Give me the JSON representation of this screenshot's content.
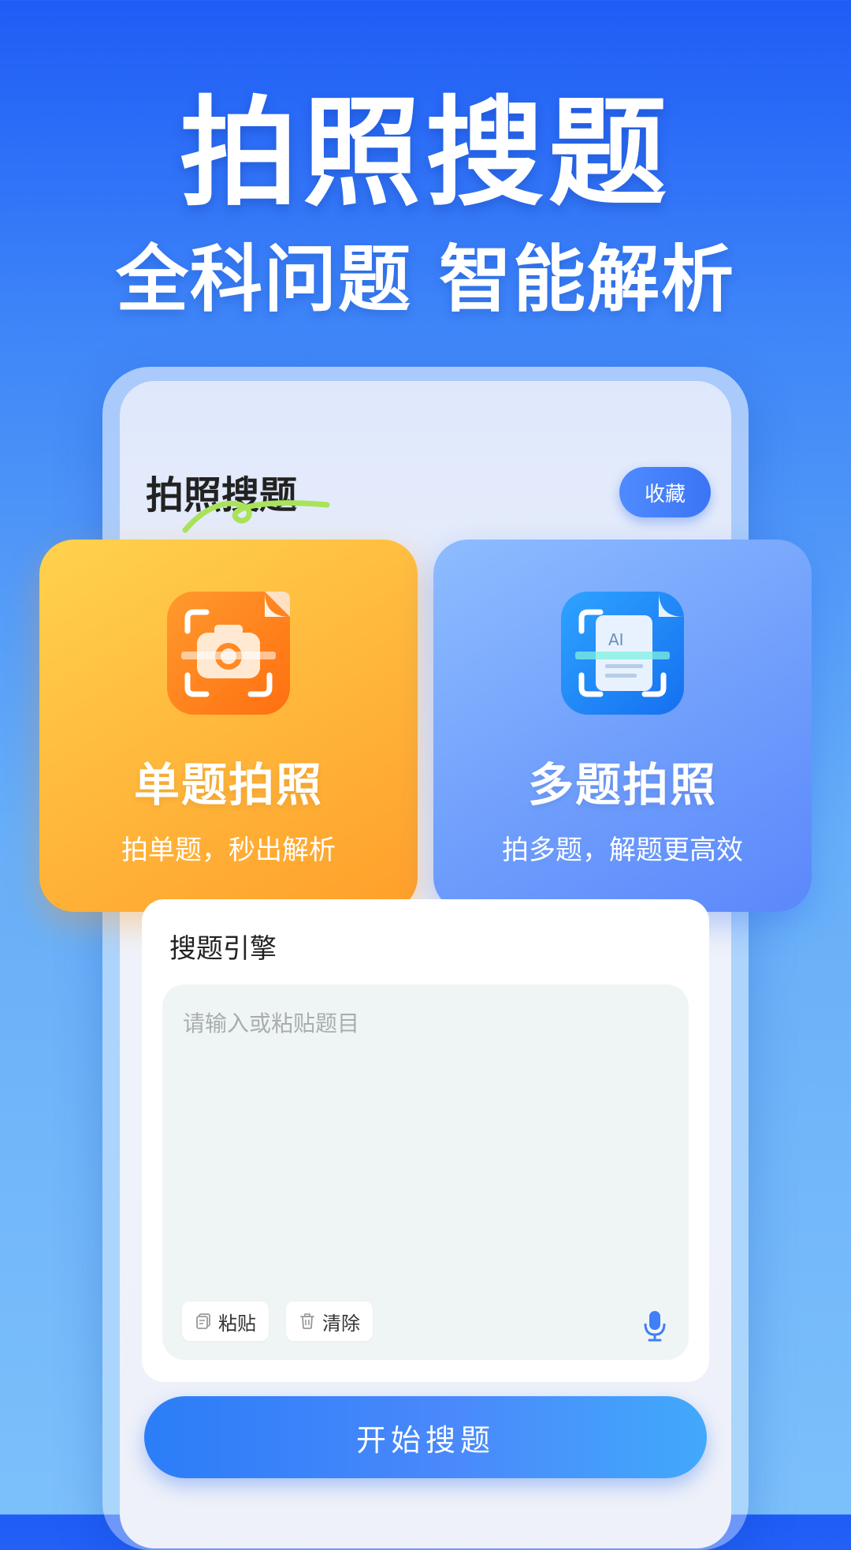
{
  "hero": {
    "title": "拍照搜题",
    "subtitle": "全科问题 智能解析"
  },
  "screen": {
    "title": "拍照搜题",
    "favorite_label": "收藏"
  },
  "cards": {
    "single": {
      "title": "单题拍照",
      "desc": "拍单题，秒出解析",
      "icon": "camera-scan-icon"
    },
    "multi": {
      "title": "多题拍照",
      "desc": "拍多题，解题更高效",
      "icon": "ai-document-scan-icon"
    }
  },
  "engine": {
    "label": "搜题引擎",
    "placeholder": "请输入或粘贴题目",
    "paste_label": "粘贴",
    "clear_label": "清除"
  },
  "start_label": "开始搜题",
  "colors": {
    "brand_blue": "#3b74f5",
    "orange": "#ffb53a",
    "text_dark": "#222222"
  }
}
